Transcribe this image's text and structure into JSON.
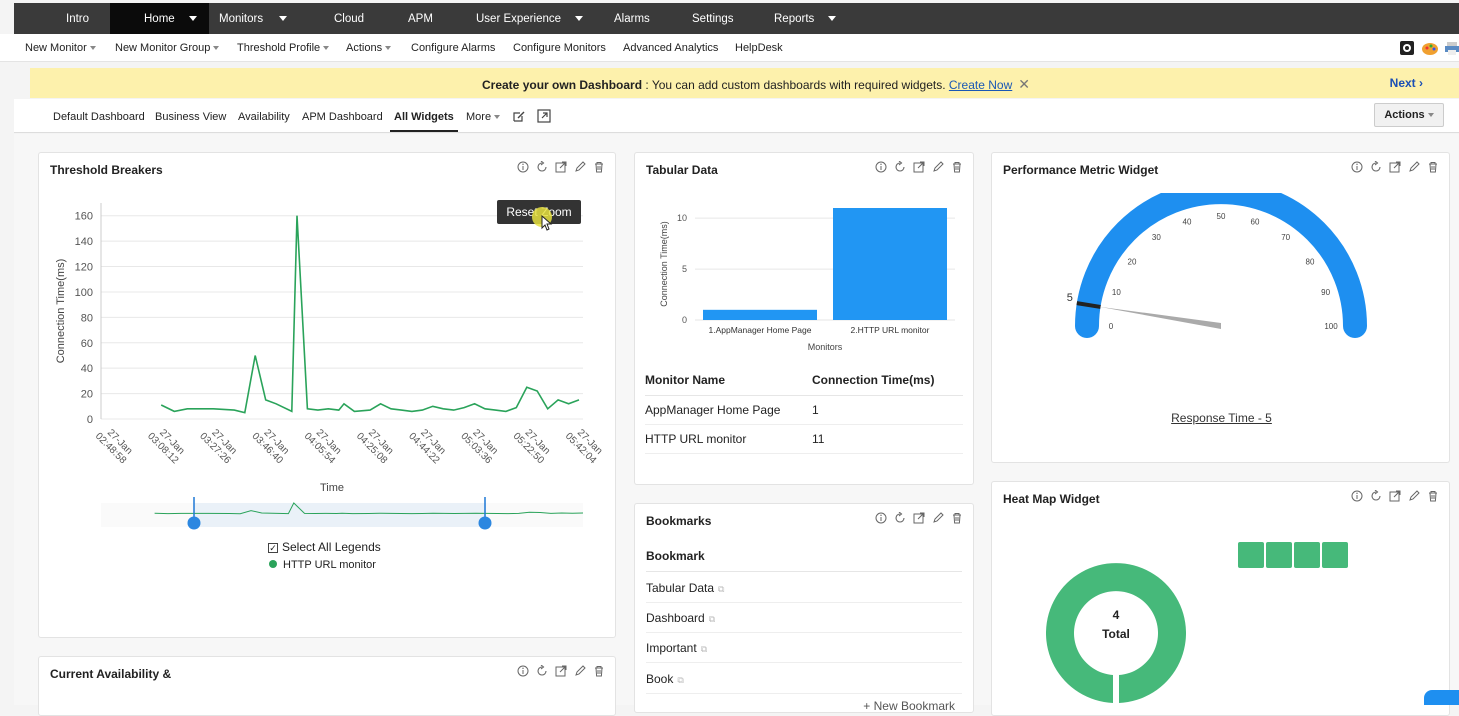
{
  "topnav": {
    "items": [
      {
        "label": "Intro",
        "caret": false,
        "active": false
      },
      {
        "label": "Home",
        "caret": true,
        "active": true
      },
      {
        "label": "Monitors",
        "caret": true,
        "active": false
      },
      {
        "label": "Cloud",
        "caret": false,
        "active": false
      },
      {
        "label": "APM",
        "caret": false,
        "active": false
      },
      {
        "label": "User Experience",
        "caret": true,
        "active": false
      },
      {
        "label": "Alarms",
        "caret": false,
        "active": false
      },
      {
        "label": "Settings",
        "caret": false,
        "active": false
      },
      {
        "label": "Reports",
        "caret": true,
        "active": false
      }
    ]
  },
  "subnav": {
    "items": [
      {
        "label": "New Monitor",
        "caret": true
      },
      {
        "label": "New Monitor Group",
        "caret": true
      },
      {
        "label": "Threshold Profile",
        "caret": true
      },
      {
        "label": "Actions",
        "caret": true
      },
      {
        "label": "Configure Alarms",
        "caret": false
      },
      {
        "label": "Configure Monitors",
        "caret": false
      },
      {
        "label": "Advanced Analytics",
        "caret": false
      },
      {
        "label": "HelpDesk",
        "caret": false
      }
    ]
  },
  "banner": {
    "bold": "Create your own Dashboard",
    "text": " : You can add custom dashboards with required widgets. ",
    "link": "Create Now",
    "close": "✕",
    "next": "Next ›"
  },
  "tabs": {
    "items": [
      "Default Dashboard",
      "Business View",
      "Availability",
      "APM Dashboard",
      "All Widgets"
    ],
    "more": "More",
    "active": "All Widgets",
    "actions": "Actions"
  },
  "threshold": {
    "title": "Threshold Breakers",
    "reset_zoom": "Reset Zoom",
    "legend_select_all": "Select All Legends",
    "series_name": "HTTP URL monitor",
    "series_color": "#2aa35a"
  },
  "tabular": {
    "title": "Tabular Data",
    "table_headers": [
      "Monitor Name",
      "Connection Time(ms)"
    ],
    "rows": [
      [
        "AppManager Home Page",
        "1"
      ],
      [
        "HTTP URL monitor",
        "11"
      ]
    ]
  },
  "bookmarks": {
    "title": "Bookmarks",
    "header": "Bookmark",
    "items": [
      "Tabular Data",
      "Dashboard",
      "Important",
      "Book"
    ],
    "new": "+ New Bookmark"
  },
  "perf": {
    "title": "Performance Metric Widget",
    "link": "Response Time - 5",
    "value": 5,
    "min": 0,
    "max": 100,
    "ticks": [
      "0",
      "10",
      "20",
      "30",
      "40",
      "50",
      "60",
      "70",
      "80",
      "90",
      "100"
    ],
    "marker_label": "5",
    "color": "#1e8ff0"
  },
  "heatmap": {
    "title": "Heat Map Widget",
    "total_value": "4",
    "total_label": "Total",
    "squares": 4,
    "color": "#46b97a"
  },
  "availability": {
    "title": "Current Availability &"
  },
  "chart_data": [
    {
      "type": "line",
      "title": "Threshold Breakers",
      "xlabel": "Time",
      "ylabel": "Connection Time(ms)",
      "ylim": [
        0,
        170
      ],
      "yticks": [
        0,
        20,
        40,
        60,
        80,
        100,
        120,
        140,
        160
      ],
      "xticks": [
        "27-Jan 02:48:58",
        "27-Jan 03:08:12",
        "27-Jan 03:27:26",
        "27-Jan 03:46:40",
        "27-Jan 04:05:54",
        "27-Jan 04:25:08",
        "27-Jan 04:44:22",
        "27-Jan 05:03:36",
        "27-Jan 05:22:50",
        "27-Jan 05:42:04"
      ],
      "grid": true,
      "series": [
        {
          "name": "HTTP URL monitor",
          "x": [
            2.0,
            2.25,
            2.5,
            3.0,
            3.4,
            3.6,
            3.8,
            4.0,
            4.2,
            4.5,
            4.6,
            4.8,
            5.0,
            5.2,
            5.4,
            5.5,
            5.7,
            6.0,
            6.2,
            6.4,
            6.6,
            6.8,
            7.0,
            7.2,
            7.4,
            7.6,
            7.8,
            8.0,
            8.2,
            8.4,
            8.6,
            8.8,
            9.0,
            9.2,
            9.4,
            9.6,
            9.8,
            10.0
          ],
          "values": [
            11,
            6,
            8,
            8,
            7,
            5,
            50,
            15,
            12,
            6,
            160,
            8,
            7,
            8,
            7,
            12,
            6,
            7,
            12,
            8,
            7,
            6,
            7,
            10,
            8,
            7,
            9,
            12,
            8,
            7,
            6,
            9,
            25,
            22,
            8,
            15,
            12,
            15
          ]
        }
      ]
    },
    {
      "type": "bar",
      "title": "Tabular Data",
      "xlabel": "Monitors",
      "ylabel": "Connection Time(ms)",
      "categories": [
        "1.AppManager Home Page",
        "2.HTTP URL monitor"
      ],
      "values": [
        1,
        11
      ],
      "ylim": [
        0,
        11
      ],
      "yticks": [
        0,
        5,
        10
      ],
      "color": "#2196f3"
    }
  ]
}
